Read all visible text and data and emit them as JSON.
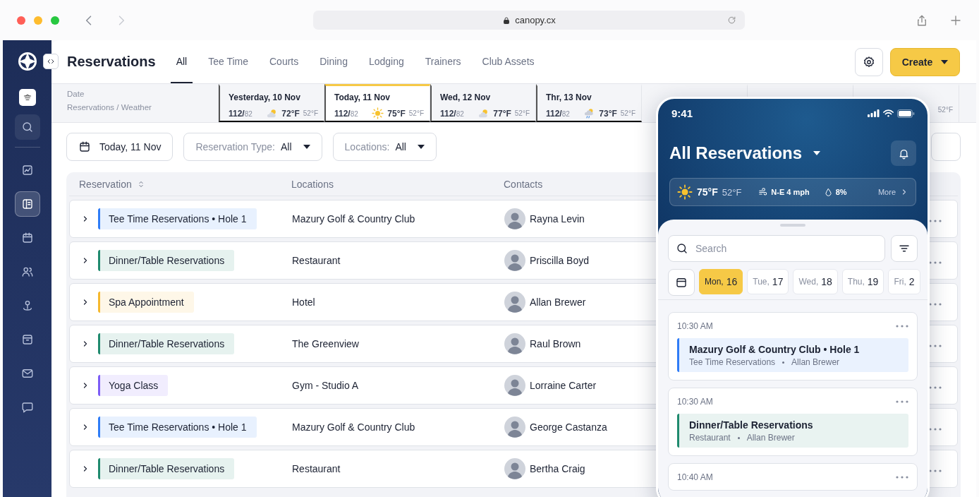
{
  "browser": {
    "url": "canopy.cx"
  },
  "sidebar": {
    "items": [
      {
        "selected": false
      },
      {
        "selected": true
      },
      {
        "selected": false
      },
      {
        "selected": false
      },
      {
        "selected": false
      },
      {
        "selected": false
      },
      {
        "selected": false
      },
      {
        "selected": false
      }
    ]
  },
  "page": {
    "title": "Reservations",
    "create_button": "Create",
    "tabs": [
      {
        "label": "All",
        "selected": true
      },
      {
        "label": "Tee Time",
        "selected": false
      },
      {
        "label": "Courts",
        "selected": false
      },
      {
        "label": "Dining",
        "selected": false
      },
      {
        "label": "Lodging",
        "selected": false
      },
      {
        "label": "Trainers",
        "selected": false
      },
      {
        "label": "Club Assets",
        "selected": false
      }
    ]
  },
  "date_strip": {
    "header_1": "Date",
    "header_2": "Reservations / Weather",
    "days": [
      {
        "label": "Yesterday, 10 Nov",
        "reservations": "112/",
        "capacity": "82",
        "kind": "partly-cloudy",
        "high": "72°F",
        "low": "52°F",
        "selected": false
      },
      {
        "label": "Today, 11 Nov",
        "reservations": "112/",
        "capacity": "82",
        "kind": "sunny",
        "high": "75°F",
        "low": "52°F",
        "selected": true
      },
      {
        "label": "Wed, 12 Nov",
        "reservations": "112/",
        "capacity": "82",
        "kind": "partly-cloudy",
        "high": "77°F",
        "low": "52°F",
        "selected": false
      },
      {
        "label": "Thr, 13 Nov",
        "reservations": "112/",
        "capacity": "82",
        "kind": "rain",
        "high": "73°F",
        "low": "52°F",
        "selected": false
      },
      {
        "selected": false
      },
      {
        "selected": false
      },
      {
        "low": "52°F",
        "selected": false
      }
    ]
  },
  "filters": {
    "date": "Today, 11 Nov",
    "type": {
      "label": "Reservation Type:",
      "value": "All"
    },
    "location": {
      "label": "Locations:",
      "value": "All"
    }
  },
  "table": {
    "columns": [
      "Reservation",
      "Locations",
      "Contacts"
    ],
    "rows": [
      {
        "type": "Tee Time Reservations • Hole 1",
        "color": "#2f7cf6",
        "location": "Mazury Golf & Country Club",
        "contact": "Rayna Levin"
      },
      {
        "type": "Dinner/Table Reservations",
        "color": "#1f8a6e",
        "location": "Restaurant",
        "contact": "Priscilla Boyd"
      },
      {
        "type": "Spa Appointment",
        "color": "#f5b82e",
        "location": "Hotel",
        "contact": "Allan Brewer"
      },
      {
        "type": "Dinner/Table Reservations",
        "color": "#1f8a6e",
        "location": "The Greenview",
        "contact": "Raul Brown"
      },
      {
        "type": "Yoga Class",
        "color": "#7c5cf5",
        "location": "Gym - Studio A",
        "contact": "Lorraine Carter"
      },
      {
        "type": "Tee Time Reservations • Hole 1",
        "color": "#2f7cf6",
        "location": "Mazury Golf & Country Club",
        "contact": "George Castanza"
      },
      {
        "type": "Dinner/Table Reservations",
        "color": "#1f8a6e",
        "location": "Restaurant",
        "contact": "Bertha Craig"
      }
    ]
  },
  "phone": {
    "time": "9:41",
    "title": "All Reservations",
    "weather": {
      "kind": "sunny",
      "high": "75°F",
      "low": "52°F",
      "wind": "N-E 4 mph",
      "rain": "8%",
      "more": "More"
    },
    "search": {
      "placeholder": "Search"
    },
    "days": [
      {
        "weekday": "Mon,",
        "day": "16",
        "selected": true
      },
      {
        "weekday": "Tue,",
        "day": "17",
        "selected": false
      },
      {
        "weekday": "Wed,",
        "day": "18",
        "selected": false
      },
      {
        "weekday": "Thu,",
        "day": "19",
        "selected": false
      },
      {
        "weekday": "Fri,",
        "day": "2",
        "selected": false
      }
    ],
    "cards": [
      {
        "time": "10:30 AM",
        "title": "Mazury Golf & Country Club • Hole 1",
        "type": "Tee Time Reservations",
        "contact": "Allan Brewer",
        "color": "#2f7cf6"
      },
      {
        "time": "10:30 AM",
        "title": "Dinner/Table Reservations",
        "type": "Restaurant",
        "contact": "Allan Brewer",
        "color": "#1f8a6e"
      },
      {
        "time": "10:40 AM"
      }
    ]
  }
}
